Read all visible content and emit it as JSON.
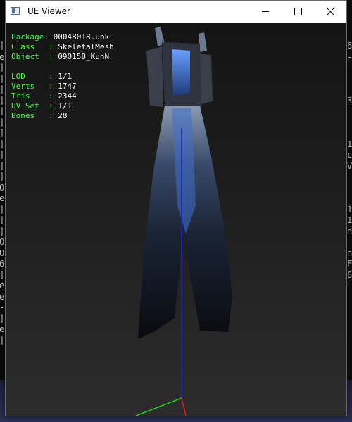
{
  "window": {
    "title": "UE Viewer"
  },
  "info": {
    "package_label": "Package: ",
    "package": "00048018.upk",
    "class_label": "Class   : ",
    "class": "SkeletalMesh",
    "object_label": "Object  : ",
    "object": "090158_KunN",
    "lod_label": "LOD     : ",
    "lod": "1/1",
    "verts_label": "Verts   : ",
    "verts": "1747",
    "tris_label": "Tris    : ",
    "tris": "2344",
    "uvset_label": "UV Set  : ",
    "uvset": "1/1",
    "bones_label": "Bones   : ",
    "bones": "28"
  },
  "background_console": {
    "left_chars": [
      "]",
      "e",
      "]",
      "]",
      "]",
      "]",
      "]",
      "]",
      "]",
      "]",
      "]",
      "]",
      "]",
      "O",
      "e",
      "]",
      "]",
      "]",
      "O",
      "O",
      "6",
      "]",
      "e",
      "e",
      "-",
      "]",
      "e",
      "]"
    ],
    "right_chars": [
      "6",
      "-",
      "",
      "",
      "",
      "3",
      "",
      "",
      "",
      "1",
      "c",
      "V",
      "",
      "",
      "",
      "1",
      "1",
      "n",
      "",
      "n",
      "F",
      "6",
      "-"
    ]
  },
  "colors": {
    "info_label": "#40ff40",
    "info_value": "#ffffff",
    "bone_axis": "#2020d0",
    "axis_red": "#e02020",
    "axis_green": "#20d020"
  },
  "icons": [
    "app-icon",
    "minimize-icon",
    "maximize-icon",
    "close-icon"
  ]
}
